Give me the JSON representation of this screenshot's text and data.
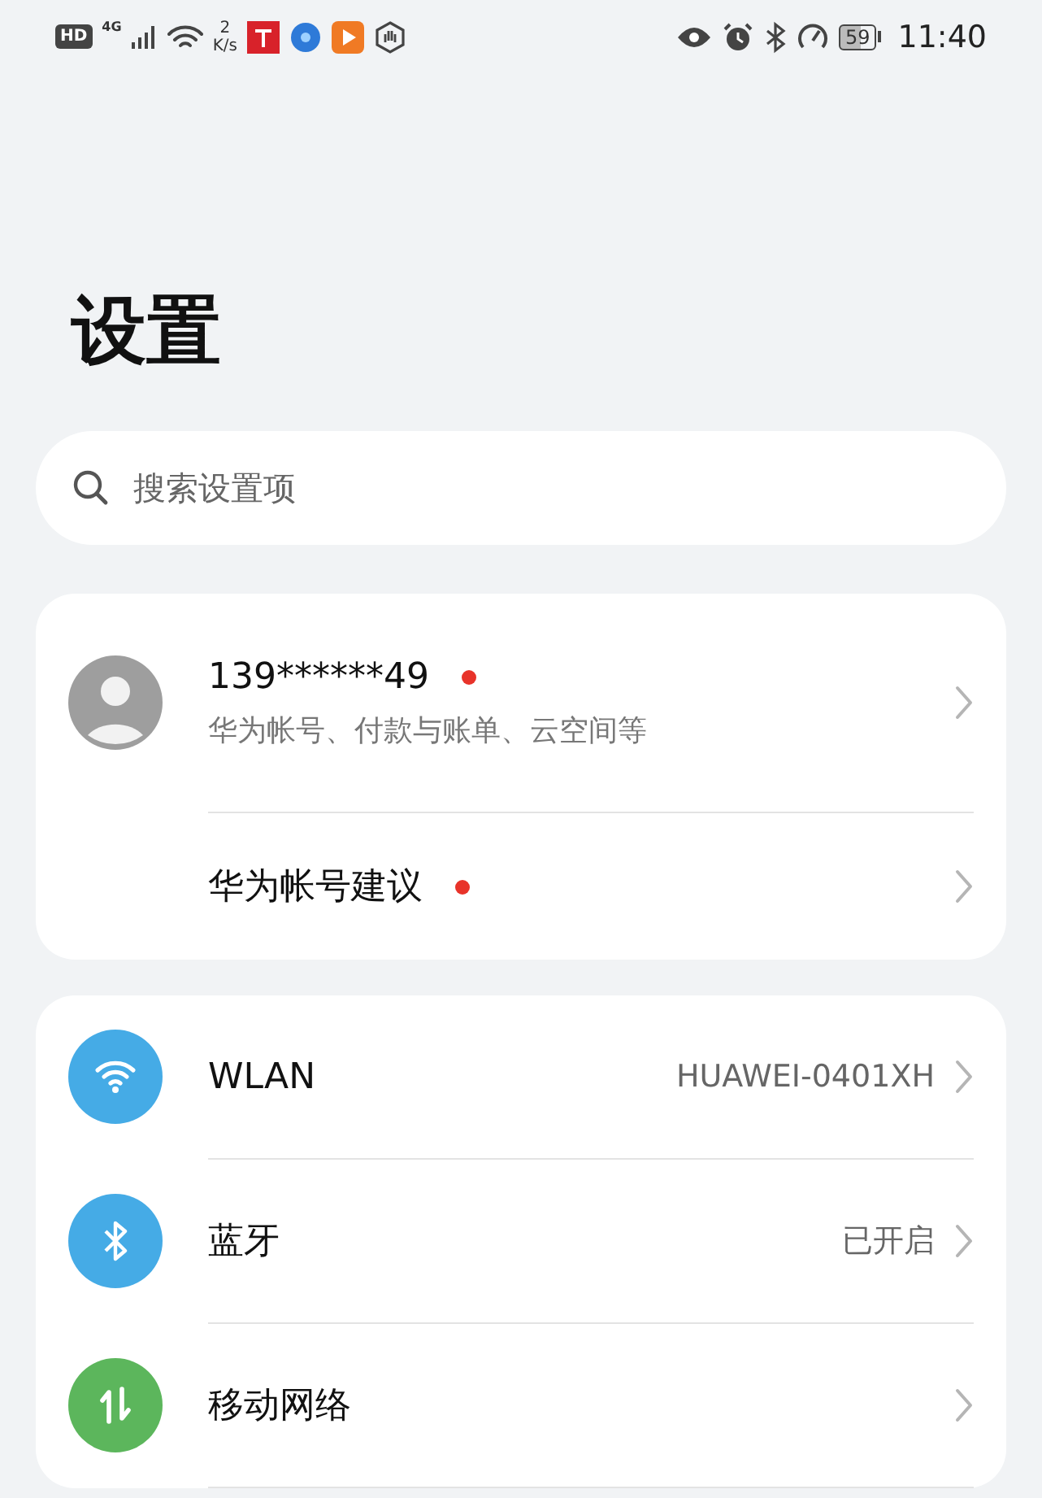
{
  "status_bar": {
    "hd": "HD",
    "network": "4G",
    "speed_value": "2",
    "speed_unit": "K/s",
    "battery": "59",
    "time": "11:40"
  },
  "title": "设置",
  "search": {
    "placeholder": "搜索设置项"
  },
  "account": {
    "name": "139******49",
    "name_badge": true,
    "subtitle": "华为帐号、付款与账单、云空间等",
    "suggestion": "华为帐号建议",
    "suggestion_badge": true
  },
  "settings": [
    {
      "kind": "wlan",
      "label": "WLAN",
      "value": "HUAWEI-0401XH",
      "color": "#45abe6"
    },
    {
      "kind": "bluetooth",
      "label": "蓝牙",
      "value": "已开启",
      "color": "#45abe6"
    },
    {
      "kind": "mobile",
      "label": "移动网络",
      "color": "#5cb65c"
    }
  ]
}
